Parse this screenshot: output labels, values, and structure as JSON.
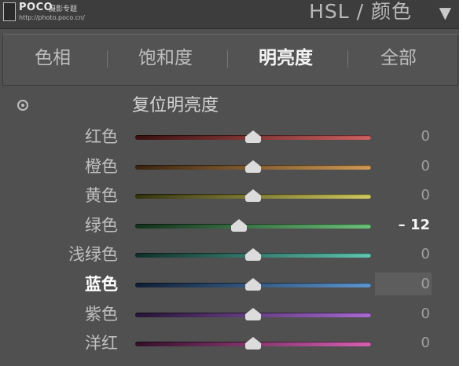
{
  "header": {
    "logo_text": "POCO",
    "logo_subtext": "摄影专题",
    "logo_url": "http://photo.poco.cn/",
    "title": "HSL / 颜色",
    "collapse_icon": "triangle-down-icon"
  },
  "tabs": [
    {
      "label": "色相",
      "active": false
    },
    {
      "label": "饱和度",
      "active": false
    },
    {
      "label": "明亮度",
      "active": true
    },
    {
      "label": "全部",
      "active": false
    }
  ],
  "reset": {
    "label": "复位明亮度",
    "icon": "target-adjust-icon"
  },
  "rows": [
    {
      "label": "红色",
      "value": "0",
      "level": 0,
      "colors": [
        "#3a1010",
        "#d06060"
      ],
      "active": false
    },
    {
      "label": "橙色",
      "value": "0",
      "level": 0,
      "colors": [
        "#3a2410",
        "#d09a55"
      ],
      "active": false
    },
    {
      "label": "黄色",
      "value": "0",
      "level": 0,
      "colors": [
        "#33330f",
        "#cfc860"
      ],
      "active": false
    },
    {
      "label": "绿色",
      "value": "– 12",
      "level": -12,
      "colors": [
        "#12301a",
        "#6cc27a"
      ],
      "active": false
    },
    {
      "label": "浅绿色",
      "value": "0",
      "level": 0,
      "colors": [
        "#0f302a",
        "#5ec6b0"
      ],
      "active": false
    },
    {
      "label": "蓝色",
      "value": "0",
      "level": 0,
      "colors": [
        "#0f1e35",
        "#5c96d0"
      ],
      "active": true
    },
    {
      "label": "紫色",
      "value": "0",
      "level": 0,
      "colors": [
        "#261436",
        "#a86ad2"
      ],
      "active": false
    },
    {
      "label": "洋红",
      "value": "0",
      "level": 0,
      "colors": [
        "#34102a",
        "#d660b2"
      ],
      "active": false
    }
  ]
}
